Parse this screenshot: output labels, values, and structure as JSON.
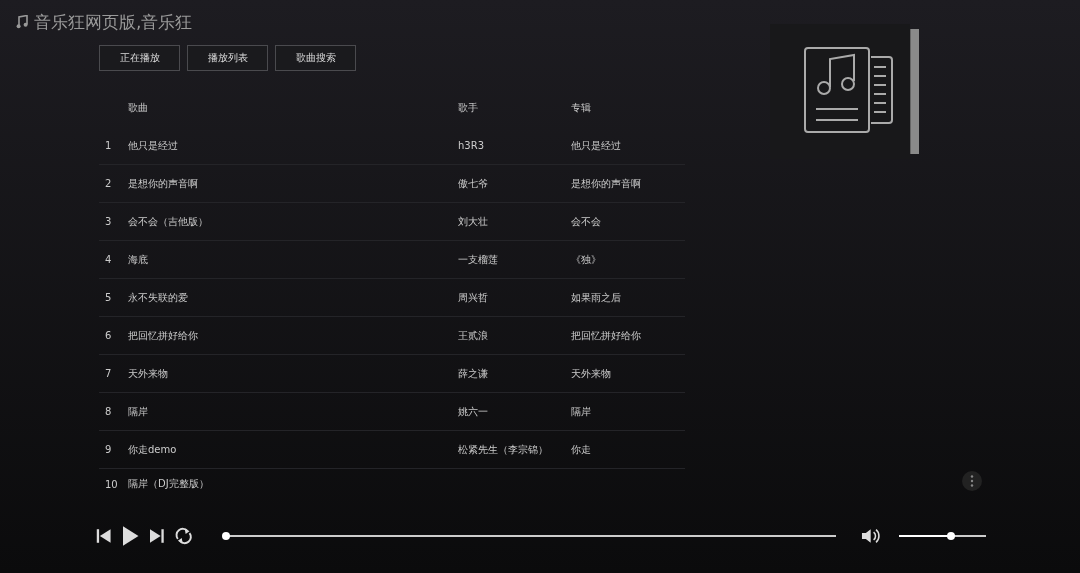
{
  "window": {
    "title": "音乐狂网页版,音乐狂"
  },
  "tabs": [
    {
      "label": "正在播放",
      "selected": false
    },
    {
      "label": "播放列表",
      "selected": false
    },
    {
      "label": "歌曲搜索",
      "selected": false
    }
  ],
  "table": {
    "columns": [
      "歌曲",
      "歌手",
      "专辑"
    ],
    "rows": [
      {
        "index": "1",
        "song": "他只是经过",
        "artist": "h3R3",
        "album": "他只是经过"
      },
      {
        "index": "2",
        "song": "是想你的声音啊",
        "artist": "傲七爷",
        "album": "是想你的声音啊"
      },
      {
        "index": "3",
        "song": "会不会（吉他版）",
        "artist": "刘大壮",
        "album": "会不会"
      },
      {
        "index": "4",
        "song": "海底",
        "artist": "一支榴莲",
        "album": "《独》"
      },
      {
        "index": "5",
        "song": "永不失联的爱",
        "artist": "周兴哲",
        "album": "如果雨之后"
      },
      {
        "index": "6",
        "song": "把回忆拼好给你",
        "artist": "王贰浪",
        "album": "把回忆拼好给你"
      },
      {
        "index": "7",
        "song": "天外来物",
        "artist": "薛之谦",
        "album": "天外来物"
      },
      {
        "index": "8",
        "song": "隔岸",
        "artist": "姚六一",
        "album": "隔岸"
      },
      {
        "index": "9",
        "song": "你走demo",
        "artist": "松紧先生（李宗锦）",
        "album": "你走"
      },
      {
        "index": "10",
        "song": "隔岸（DJ完整版）"
      }
    ]
  },
  "player": {
    "progress": {
      "level": 0
    },
    "volume": {
      "level": 0.6
    }
  }
}
